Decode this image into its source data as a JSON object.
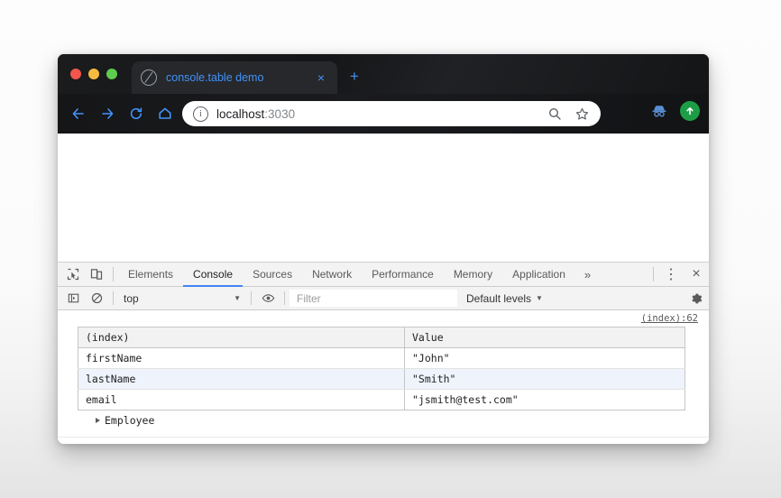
{
  "window": {
    "traffic_lights": [
      {
        "name": "close",
        "color": "#f2564c"
      },
      {
        "name": "minimize",
        "color": "#f4bc3f"
      },
      {
        "name": "zoom",
        "color": "#5fcc4e"
      }
    ]
  },
  "tabstrip": {
    "tab_title": "console.table demo",
    "tab_close_label": "×",
    "new_tab_label": "+"
  },
  "navbar": {
    "back_icon": "arrow-left-icon",
    "forward_icon": "arrow-right-icon",
    "reload_icon": "reload-icon",
    "home_icon": "home-icon",
    "info_label": "i",
    "url_host": "localhost",
    "url_port": ":3030",
    "search_icon": "search-icon",
    "bookmark_icon": "star-icon",
    "incognito_icon": "incognito-icon",
    "profile_icon": "profile-avatar-upload-icon"
  },
  "devtools": {
    "tabs": [
      {
        "label": "Elements",
        "active": false
      },
      {
        "label": "Console",
        "active": true
      },
      {
        "label": "Sources",
        "active": false
      },
      {
        "label": "Network",
        "active": false
      },
      {
        "label": "Performance",
        "active": false
      },
      {
        "label": "Memory",
        "active": false
      },
      {
        "label": "Application",
        "active": false
      }
    ],
    "overflow_label": "»",
    "inspect_icon": "inspect-element-icon",
    "device_icon": "device-toolbar-icon",
    "kebab_label": "⋮",
    "close_label": "×",
    "toolbar": {
      "sidebar_icon": "console-sidebar-icon",
      "clear_icon": "clear-console-icon",
      "context": "top",
      "context_caret": "▼",
      "eye_icon": "live-expression-eye-icon",
      "filter_placeholder": "Filter",
      "levels": "Default levels",
      "levels_caret": "▼",
      "settings_icon": "gear-icon"
    }
  },
  "console": {
    "source_link": "(index):62",
    "table": {
      "columns": [
        "(index)",
        "Value"
      ],
      "rows": [
        {
          "index": "firstName",
          "value": "\"John\""
        },
        {
          "index": "lastName",
          "value": "\"Smith\""
        },
        {
          "index": "email",
          "value": "\"jsmith@test.com\""
        }
      ]
    },
    "expand_label": "Employee",
    "prompt_caret": "›"
  }
}
